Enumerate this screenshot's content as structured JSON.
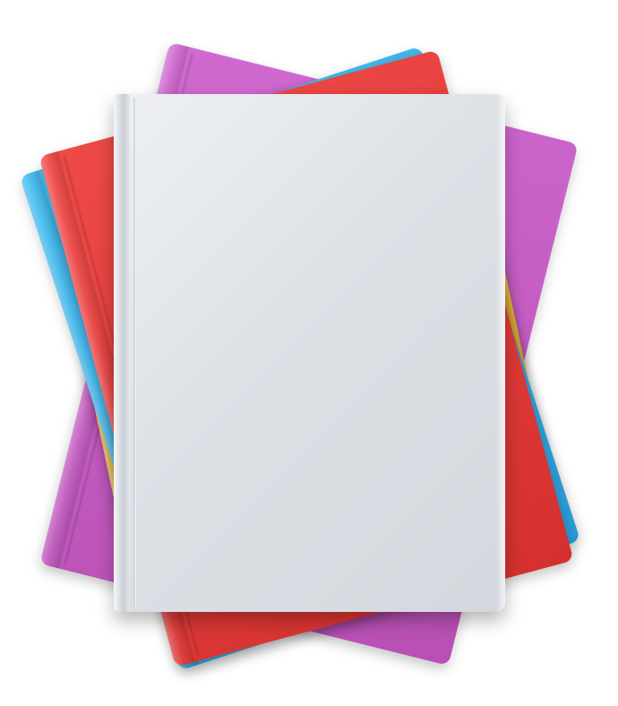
{
  "scene": {
    "subject": "stack-of-books",
    "colors": {
      "magenta": "#c45bbf",
      "red": "#e03a3a",
      "blue": "#35aee6",
      "yellow": "#e9bf3f",
      "white_cover": "#dde1e6",
      "background": "#ffffff"
    }
  }
}
